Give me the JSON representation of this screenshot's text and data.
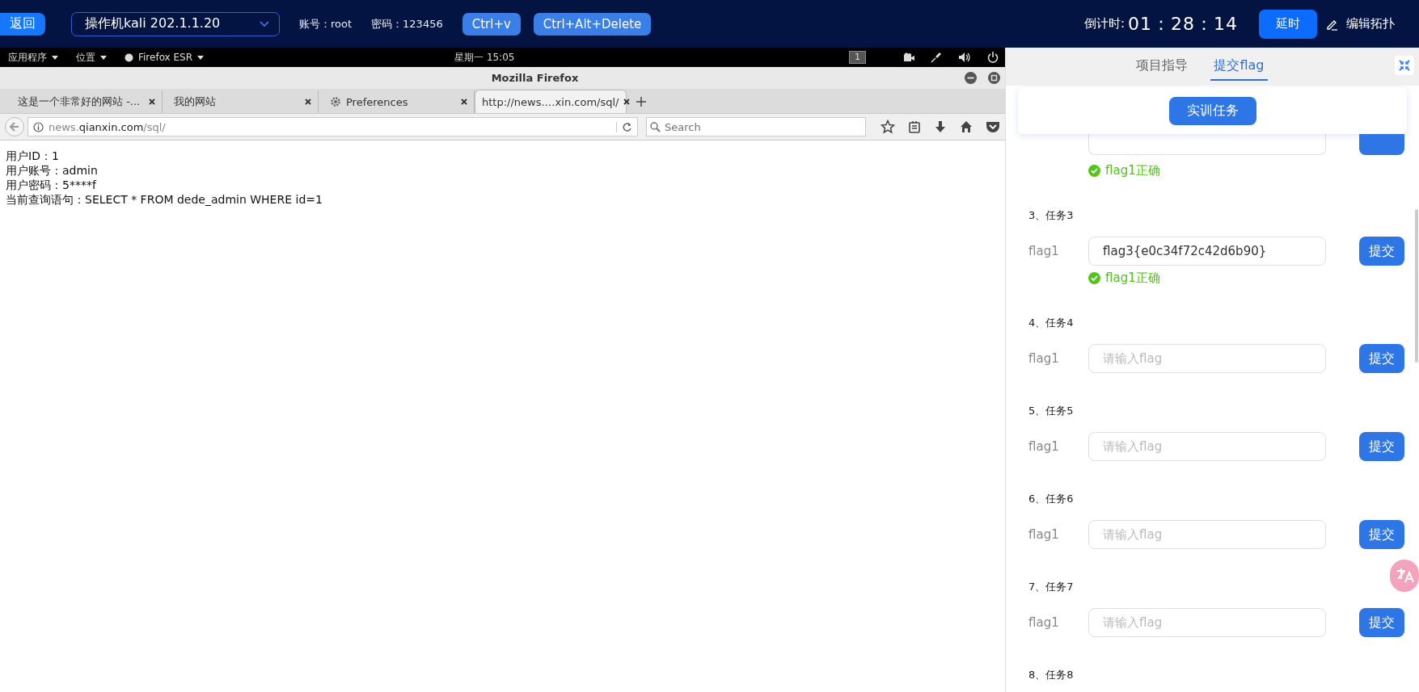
{
  "top_bar": {
    "back_button": "返回",
    "machine_select": "操作机kali 202.1.1.20",
    "account_label": "账号：",
    "account": "root",
    "password_label": "密码：",
    "password": "123456",
    "keys": [
      "Ctrl+v",
      "Ctrl+Alt+Delete"
    ],
    "countdown_label": "倒计时:",
    "countdown": "01：28：14",
    "extend_button": "延时",
    "edit_topology": "编辑拓扑"
  },
  "desktop": {
    "menus": [
      "应用程序",
      "位置",
      "Firefox ESR"
    ],
    "clock": "星期一 15:05",
    "workspace": "1"
  },
  "browser": {
    "title": "Mozilla Firefox",
    "tabs": [
      {
        "label": "这是一个非常好的网站 -...",
        "kind": "page",
        "selected": false
      },
      {
        "label": "我的网站",
        "kind": "page",
        "selected": false
      },
      {
        "label": "Preferences",
        "kind": "settings",
        "selected": false
      },
      {
        "label": "http://news.…xin.com/sql/",
        "kind": "page",
        "selected": true
      }
    ],
    "url": {
      "prefix": "news.",
      "domain": "qianxin.com",
      "path": "/sql/"
    },
    "search": {
      "placeholder": "Search"
    },
    "content": [
      "用户ID：1",
      "用户账号：admin",
      "用户密码：5****f",
      "当前查询语句：SELECT * FROM dede_admin WHERE id=1"
    ]
  },
  "panel": {
    "tabs": [
      {
        "label": "项目指导",
        "selected": false
      },
      {
        "label": "提交flag",
        "selected": true
      }
    ],
    "task_button": "实训任务",
    "tasks": [
      {
        "fields": [
          {
            "result": {
              "text": "flag1正确",
              "correct": true
            }
          }
        ]
      },
      {
        "title": "3、任务3",
        "fields": [
          {
            "label": "flag1",
            "value": "flag3{e0c34f72c42d6b90}",
            "submit": "提交",
            "result": {
              "text": "flag1正确",
              "correct": true
            }
          }
        ]
      },
      {
        "title": "4、任务4",
        "fields": [
          {
            "label": "flag1",
            "placeholder": "请输入flag",
            "submit": "提交"
          }
        ]
      },
      {
        "title": "5、任务5",
        "fields": [
          {
            "label": "flag1",
            "placeholder": "请输入flag",
            "submit": "提交"
          }
        ]
      },
      {
        "title": "6、任务6",
        "fields": [
          {
            "label": "flag1",
            "placeholder": "请输入flag",
            "submit": "提交"
          }
        ]
      },
      {
        "title": "7、任务7",
        "fields": [
          {
            "label": "flag1",
            "placeholder": "请输入flag",
            "submit": "提交"
          }
        ]
      },
      {
        "title": "8、任务8"
      }
    ]
  }
}
